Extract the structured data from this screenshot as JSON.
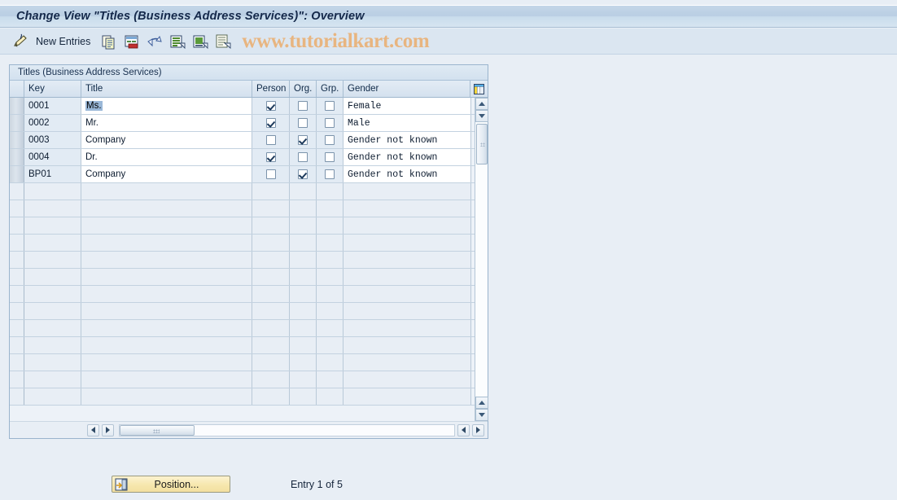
{
  "window": {
    "title": "Change View \"Titles (Business Address Services)\": Overview"
  },
  "toolbar": {
    "new_entries_label": "New Entries",
    "watermark": "www.tutorialkart.com",
    "icons": [
      "pencil-edit-icon",
      "copy-icon",
      "delete-row-icon",
      "undo-icon",
      "select-all-icon",
      "deselect-all-icon",
      "details-icon"
    ]
  },
  "panel": {
    "header": "Titles (Business Address Services)"
  },
  "table": {
    "columns": [
      {
        "key": "key",
        "label": "Key"
      },
      {
        "key": "title",
        "label": "Title"
      },
      {
        "key": "person",
        "label": "Person"
      },
      {
        "key": "org",
        "label": "Org."
      },
      {
        "key": "grp",
        "label": "Grp."
      },
      {
        "key": "gender",
        "label": "Gender"
      }
    ],
    "config_icon": "table-settings-icon",
    "rows": [
      {
        "key": "0001",
        "title": "Ms.",
        "selected_title": true,
        "person": true,
        "org": false,
        "grp": false,
        "gender": "Female"
      },
      {
        "key": "0002",
        "title": "Mr.",
        "selected_title": false,
        "person": true,
        "org": false,
        "grp": false,
        "gender": "Male"
      },
      {
        "key": "0003",
        "title": "Company",
        "selected_title": false,
        "person": false,
        "org": true,
        "grp": false,
        "gender": "Gender not known"
      },
      {
        "key": "0004",
        "title": "Dr.",
        "selected_title": false,
        "person": true,
        "org": false,
        "grp": false,
        "gender": "Gender not known"
      },
      {
        "key": "BP01",
        "title": "Company",
        "selected_title": false,
        "person": false,
        "org": true,
        "grp": false,
        "gender": "Gender not known"
      }
    ],
    "empty_row_count": 13
  },
  "footer": {
    "position_button_label": "Position...",
    "position_button_icon": "position-icon",
    "entry_status": "Entry 1 of 5"
  },
  "colors": {
    "background": "#e8eef5",
    "titlebar": "#c4d6e8",
    "accent_text": "#14284a",
    "watermark": "#e8b580",
    "button_yellow": "#f6e7ae",
    "selection_blue": "#9ab8d8"
  }
}
